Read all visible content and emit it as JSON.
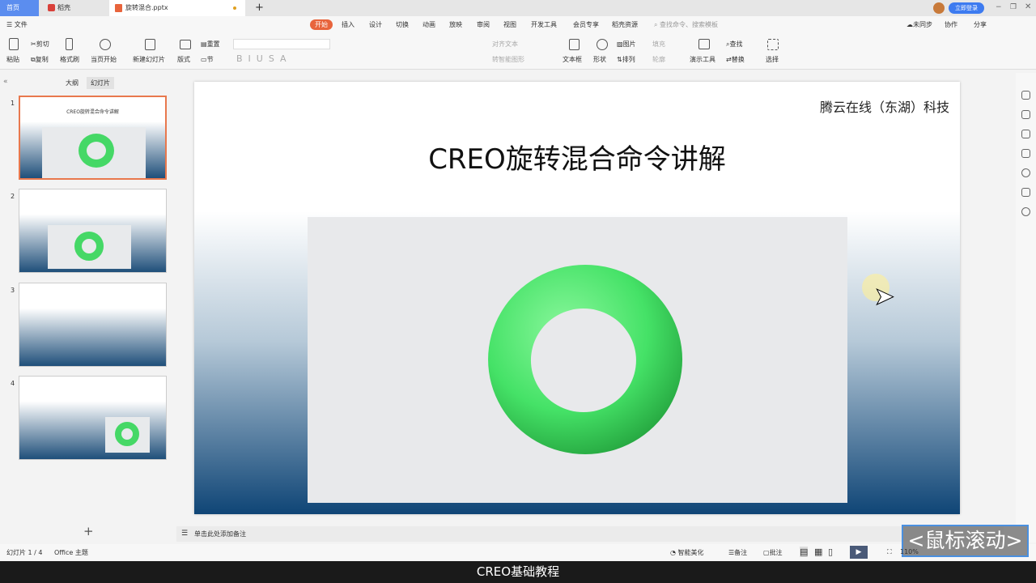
{
  "tabs": {
    "home": "首页",
    "daoke": "稻壳",
    "doc": "旋转混合.pptx",
    "login": "立即登录"
  },
  "menu": {
    "file": "文件",
    "items": [
      "开始",
      "插入",
      "设计",
      "切换",
      "动画",
      "放映",
      "审阅",
      "视图",
      "开发工具",
      "会员专享",
      "稻壳资源"
    ],
    "search_placeholder": "查找命令、搜索模板",
    "sync": "未同步",
    "collab": "协作",
    "share": "分享"
  },
  "toolbar": {
    "paste": "粘贴",
    "cut": "剪切",
    "copy": "复制",
    "format_painter": "格式刷",
    "play_current": "当页开始",
    "new_slide": "新建幻灯片",
    "layout": "版式",
    "section": "节",
    "reset": "重置",
    "align_text": "对齐文本",
    "smart_art": "转智能图形",
    "textbox": "文本框",
    "shape": "形状",
    "picture": "图片",
    "fill": "填充",
    "arrange": "排列",
    "outline": "轮廓",
    "present_tools": "演示工具",
    "find": "查找",
    "replace": "替换",
    "select": "选择"
  },
  "left_panel": {
    "tab_outline": "大纲",
    "tab_slides": "幻灯片",
    "slide_numbers": [
      "1",
      "2",
      "3",
      "4"
    ],
    "thumb1_title": "CREO旋转混合命令讲解"
  },
  "slide": {
    "company": "腾云在线（东湖）科技",
    "title": "CREO旋转混合命令讲解"
  },
  "notes": {
    "placeholder": "单击此处添加备注"
  },
  "status": {
    "slide_index": "幻灯片 1 / 4",
    "theme": "Office 主题",
    "beautify": "智能美化",
    "notes": "备注",
    "comment": "批注",
    "zoom": "110%"
  },
  "overlay": {
    "scroll_hint": "<鼠标滚动>"
  },
  "caption": "CREO基础教程",
  "colors": {
    "accent": "#e8643c",
    "home_tab": "#5b8def",
    "torus": "#44e36a"
  }
}
